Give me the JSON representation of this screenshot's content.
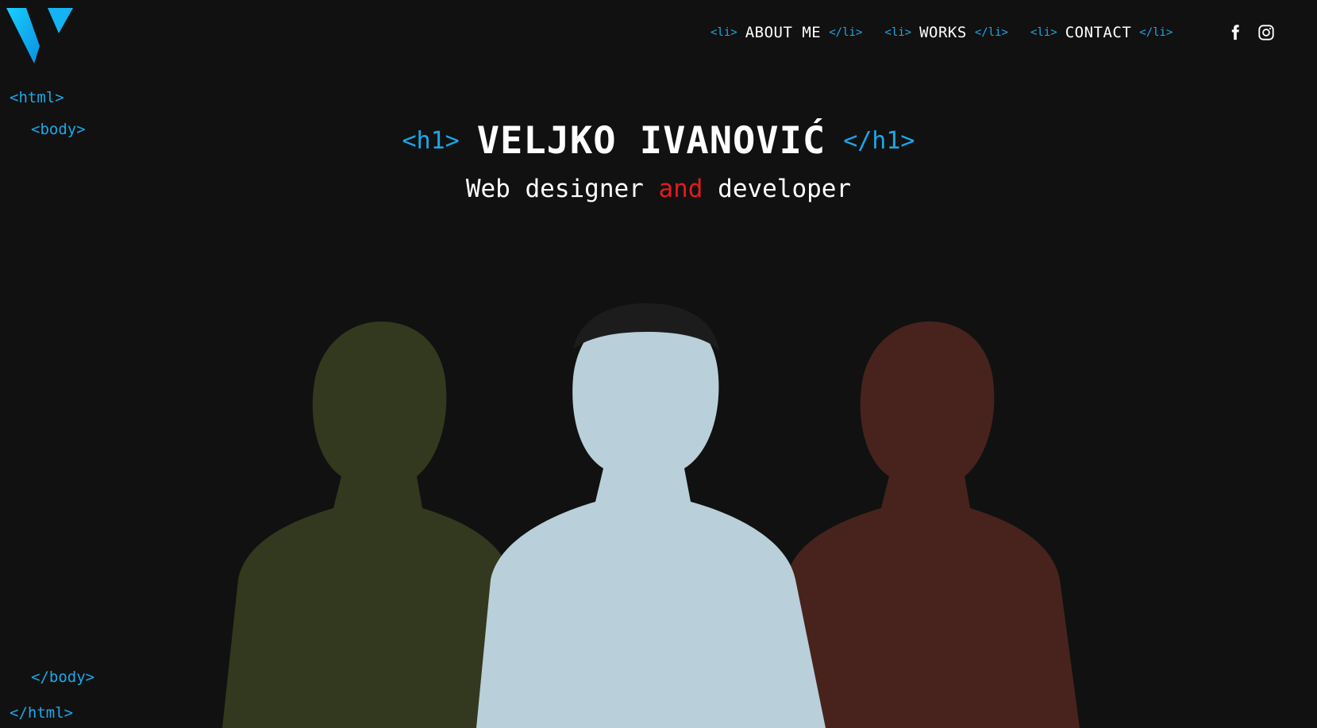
{
  "logo": {
    "icon": "v-logo-icon",
    "color": "#14b4f4"
  },
  "code_tags": {
    "html_open": "<html>",
    "body_open": "<body>",
    "body_close": "</body>",
    "html_close": "</html>"
  },
  "nav": {
    "tag_open": "<li>",
    "tag_close": "</li>",
    "items": [
      {
        "label": "ABOUT ME"
      },
      {
        "label": "WORKS"
      },
      {
        "label": "CONTACT"
      }
    ],
    "social": [
      {
        "icon": "facebook-icon"
      },
      {
        "icon": "instagram-icon"
      }
    ]
  },
  "hero": {
    "h1_open": "<h1>",
    "name": "VELJKO IVANOVIĆ",
    "h1_close": "</h1>",
    "subtitle_part1": "Web designer",
    "subtitle_accent": "and",
    "subtitle_part2": "developer"
  },
  "colors": {
    "background": "#111111",
    "code_blue": "#1aa8e8",
    "accent_red": "#e11c1c",
    "portrait_left_tint": "#4f5a2a",
    "portrait_center_tint": "#b9cfd9",
    "portrait_right_tint": "#6e3026"
  }
}
